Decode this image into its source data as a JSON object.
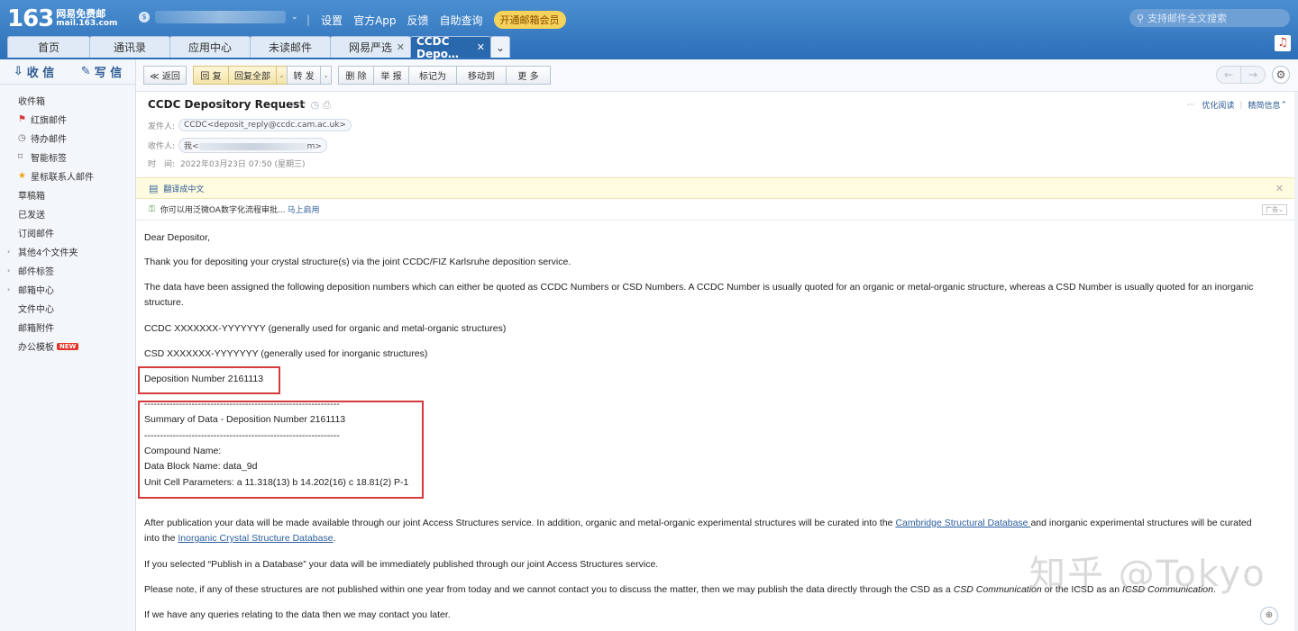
{
  "header": {
    "logo_number": "163",
    "logo_line1": "网易免费邮",
    "logo_line2": "mail.163.com",
    "account_caret": "⌄",
    "nav": [
      "设置",
      "官方App",
      "反馈",
      "自助查询"
    ],
    "vip_button": "开通邮箱会员",
    "search_placeholder": "支持邮件全文搜索"
  },
  "tabs": [
    {
      "label": "首页"
    },
    {
      "label": "通讯录"
    },
    {
      "label": "应用中心"
    },
    {
      "label": "未读邮件"
    },
    {
      "label": "网易严选"
    },
    {
      "label": "CCDC Depo…"
    }
  ],
  "sidebar": {
    "receive": "收 信",
    "write": "写 信",
    "folders": [
      {
        "label": "收件箱"
      },
      {
        "label": "红旗邮件"
      },
      {
        "label": "待办邮件"
      },
      {
        "label": "智能标签"
      },
      {
        "label": "星标联系人邮件"
      },
      {
        "label": "草稿箱"
      },
      {
        "label": "已发送"
      },
      {
        "label": "订阅邮件"
      },
      {
        "label": "其他4个文件夹"
      },
      {
        "label": "邮件标签"
      },
      {
        "label": "邮箱中心"
      },
      {
        "label": "文件中心"
      },
      {
        "label": "邮箱附件"
      },
      {
        "label": "办公模板"
      }
    ],
    "new_badge": "NEW"
  },
  "toolbar": {
    "back": "≪ 返回",
    "reply": "回 复",
    "reply_all": "回复全部",
    "forward": "转 发",
    "delete": "删 除",
    "report": "举 报",
    "mark_as": "标记为",
    "move_to": "移动到",
    "more": "更 多"
  },
  "mail": {
    "subject": "CCDC Depository Request",
    "sender_label": "发件人:",
    "sender": "CCDC<deposit_reply@ccdc.cam.ac.uk>",
    "recipient_label": "收件人:",
    "recipient_prefix": "我<",
    "recipient_suffix": "m>",
    "time_label": "时　间:",
    "time": "2022年03月23日 07:50 (星期三)",
    "optimize_read": "优化阅读",
    "brief_info": "精简信息",
    "translate": "翻译成中文",
    "ad_text": "你可以用泛微OA数字化流程审批...",
    "ad_link": "马上启用",
    "ad_tag": "广告"
  },
  "body": {
    "greeting": "Dear Depositor,",
    "p1": "Thank you for depositing your crystal structure(s) via the joint CCDC/FIZ Karlsruhe deposition service.",
    "p2": "The data have been assigned the following deposition numbers which can either be quoted as CCDC Numbers or CSD Numbers. A CCDC Number is usually quoted for an organic or metal-organic structure, whereas a CSD Number is usually quoted for an inorganic structure.",
    "ccdc_format": "CCDC XXXXXXX-YYYYYYY (generally used for organic and metal-organic structures)",
    "csd_format": "CSD XXXXXXX-YYYYYYY (generally used for inorganic structures)",
    "deposition_number": "Deposition Number 2161113",
    "dashes": "-------------------------------------------------------------------",
    "summary_title": "Summary of Data - Deposition Number 2161113",
    "compound_name": "Compound Name:",
    "data_block": "Data Block Name: data_9d",
    "unit_cell": "Unit Cell Parameters: a 11.318(13) b 14.202(16) c 18.81(2) P-1",
    "p3_a": "After publication your data will be made available through our joint Access Structures service. In addition, organic and metal-organic experimental structures will be curated into the ",
    "p3_link1": "Cambridge Structural Database ",
    "p3_b": "and inorganic experimental structures will be curated into the ",
    "p3_link2": "Inorganic Crystal Structure Database",
    "p3_c": ".",
    "p4": "If you selected “Publish in a Database” your data will be immediately published through our joint Access Structures service.",
    "p5_a": "Please note, if any of these structures are not published within one year from today and we cannot contact you to discuss the matter, then we may publish the data directly through the CSD as a ",
    "p5_i1": "CSD Communication",
    "p5_b": " or the ICSD as an ",
    "p5_i2": "ICSD Communication",
    "p5_c": ".",
    "p6": "If we have any queries relating to the data then we may contact you later."
  },
  "watermark": "知乎 @Tokyo"
}
